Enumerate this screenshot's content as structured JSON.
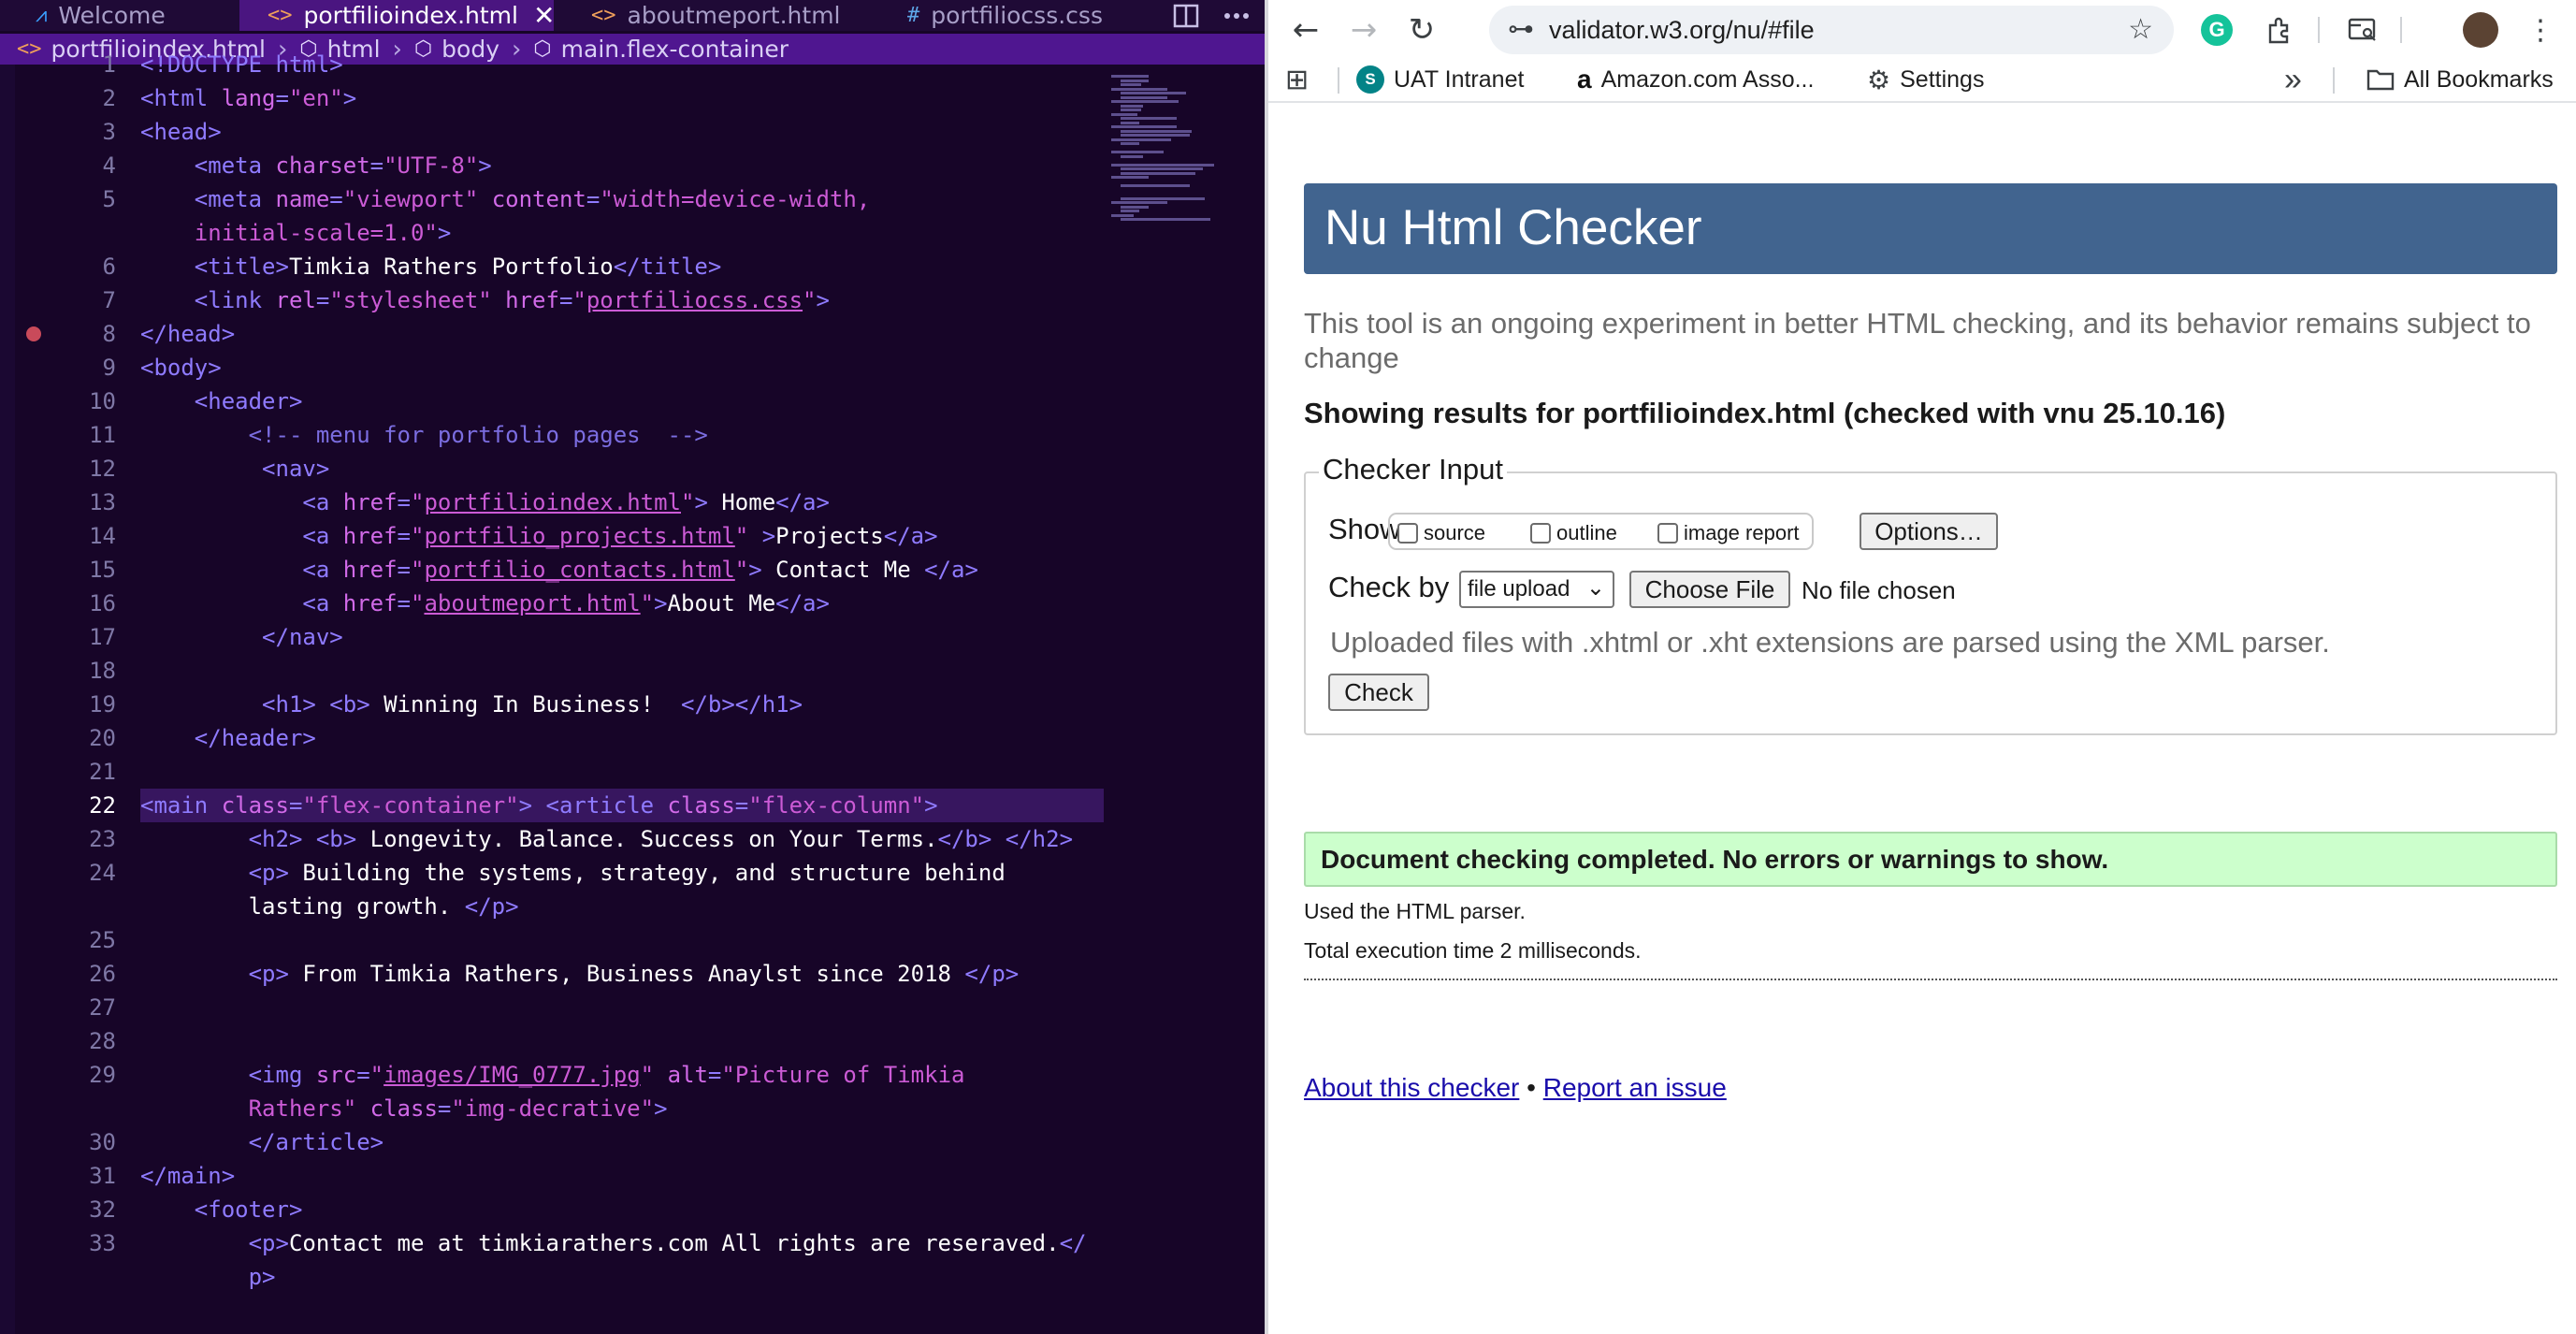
{
  "editor": {
    "tabs": [
      {
        "icon": "vscode-icon",
        "label": "Welcome",
        "active": false
      },
      {
        "icon": "html-icon",
        "label": "portfilioindex.html",
        "active": true
      },
      {
        "icon": "html-icon",
        "label": "aboutmeport.html",
        "active": false
      },
      {
        "icon": "css-icon",
        "label": "portfiliocss.css",
        "active": false
      }
    ],
    "close_glyph": "✕",
    "tab_glyphs": {
      "vscode": "⩘",
      "html": "<>",
      "css": "#"
    },
    "breadcrumb": [
      {
        "icon": "html-icon",
        "glyph": "<>",
        "label": "portfilioindex.html"
      },
      {
        "icon": "element-icon",
        "glyph": "⬡",
        "label": "html"
      },
      {
        "icon": "element-icon",
        "glyph": "⬡",
        "label": "body"
      },
      {
        "icon": "element-icon",
        "glyph": "⬡",
        "label": "main.flex-container"
      }
    ],
    "current_line": 22,
    "breakpoint_line": 8,
    "code_lines": [
      {
        "n": "1",
        "spans": [
          [
            "tag",
            "<!DOCTYPE html>"
          ]
        ]
      },
      {
        "n": "2",
        "spans": [
          [
            "tag",
            "<html "
          ],
          [
            "attr",
            "lang"
          ],
          [
            "tag",
            "="
          ],
          [
            "val",
            "\"en\""
          ],
          [
            "tag",
            ">"
          ]
        ]
      },
      {
        "n": "3",
        "spans": [
          [
            "tag",
            "<head>"
          ]
        ]
      },
      {
        "n": "4",
        "spans": [
          [
            "txt",
            "    "
          ],
          [
            "tag",
            "<meta "
          ],
          [
            "attr",
            "charset"
          ],
          [
            "tag",
            "="
          ],
          [
            "val",
            "\"UTF-8\""
          ],
          [
            "tag",
            ">"
          ]
        ]
      },
      {
        "n": "5",
        "spans": [
          [
            "txt",
            "    "
          ],
          [
            "tag",
            "<meta "
          ],
          [
            "attr",
            "name"
          ],
          [
            "tag",
            "="
          ],
          [
            "val",
            "\"viewport\""
          ],
          [
            "txt",
            " "
          ],
          [
            "attr",
            "content"
          ],
          [
            "tag",
            "="
          ],
          [
            "val",
            "\"width=device-width,"
          ]
        ]
      },
      {
        "n": "",
        "spans": [
          [
            "txt",
            "    "
          ],
          [
            "val",
            "initial-scale=1.0\""
          ],
          [
            "tag",
            ">"
          ]
        ]
      },
      {
        "n": "6",
        "spans": [
          [
            "txt",
            "    "
          ],
          [
            "tag",
            "<title>"
          ],
          [
            "txt",
            "Timkia Rathers Portfolio"
          ],
          [
            "tag",
            "</title>"
          ]
        ]
      },
      {
        "n": "7",
        "spans": [
          [
            "txt",
            "    "
          ],
          [
            "tag",
            "<link "
          ],
          [
            "attr",
            "rel"
          ],
          [
            "tag",
            "="
          ],
          [
            "val",
            "\"stylesheet\""
          ],
          [
            "txt",
            " "
          ],
          [
            "attr",
            "href"
          ],
          [
            "tag",
            "="
          ],
          [
            "val",
            "\""
          ],
          [
            "link",
            "portfiliocss.css"
          ],
          [
            "val",
            "\""
          ],
          [
            "tag",
            ">"
          ]
        ]
      },
      {
        "n": "8",
        "spans": [
          [
            "tag",
            "</head>"
          ]
        ]
      },
      {
        "n": "9",
        "spans": [
          [
            "tag",
            "<body>"
          ]
        ]
      },
      {
        "n": "10",
        "spans": [
          [
            "txt",
            "    "
          ],
          [
            "tag",
            "<header>"
          ]
        ]
      },
      {
        "n": "11",
        "spans": [
          [
            "txt",
            "        "
          ],
          [
            "com",
            "<!-- menu for portfolio pages  -->"
          ]
        ]
      },
      {
        "n": "12",
        "spans": [
          [
            "txt",
            "         "
          ],
          [
            "tag",
            "<nav>"
          ]
        ]
      },
      {
        "n": "13",
        "spans": [
          [
            "txt",
            "            "
          ],
          [
            "tag",
            "<a "
          ],
          [
            "attr",
            "href"
          ],
          [
            "tag",
            "="
          ],
          [
            "val",
            "\""
          ],
          [
            "link",
            "portfilioindex.html"
          ],
          [
            "val",
            "\""
          ],
          [
            "tag",
            ">"
          ],
          [
            "txt",
            " Home"
          ],
          [
            "tag",
            "</a>"
          ]
        ]
      },
      {
        "n": "14",
        "spans": [
          [
            "txt",
            "            "
          ],
          [
            "tag",
            "<a "
          ],
          [
            "attr",
            "href"
          ],
          [
            "tag",
            "="
          ],
          [
            "val",
            "\""
          ],
          [
            "link",
            "portfilio_projects.html"
          ],
          [
            "val",
            "\""
          ],
          [
            "txt",
            " "
          ],
          [
            "tag",
            ">"
          ],
          [
            "txt",
            "Projects"
          ],
          [
            "tag",
            "</a>"
          ]
        ]
      },
      {
        "n": "15",
        "spans": [
          [
            "txt",
            "            "
          ],
          [
            "tag",
            "<a "
          ],
          [
            "attr",
            "href"
          ],
          [
            "tag",
            "="
          ],
          [
            "val",
            "\""
          ],
          [
            "link",
            "portfilio_contacts.html"
          ],
          [
            "val",
            "\""
          ],
          [
            "tag",
            ">"
          ],
          [
            "txt",
            " Contact Me "
          ],
          [
            "tag",
            "</a>"
          ]
        ]
      },
      {
        "n": "16",
        "spans": [
          [
            "txt",
            "            "
          ],
          [
            "tag",
            "<a "
          ],
          [
            "attr",
            "href"
          ],
          [
            "tag",
            "="
          ],
          [
            "val",
            "\""
          ],
          [
            "link",
            "aboutmeport.html"
          ],
          [
            "val",
            "\""
          ],
          [
            "tag",
            ">"
          ],
          [
            "txt",
            "About Me"
          ],
          [
            "tag",
            "</a>"
          ]
        ]
      },
      {
        "n": "17",
        "spans": [
          [
            "txt",
            "         "
          ],
          [
            "tag",
            "</nav>"
          ]
        ]
      },
      {
        "n": "18",
        "spans": []
      },
      {
        "n": "19",
        "spans": [
          [
            "txt",
            "         "
          ],
          [
            "tag",
            "<h1>"
          ],
          [
            "txt",
            " "
          ],
          [
            "tag",
            "<b>"
          ],
          [
            "txt",
            " Winning In Business!  "
          ],
          [
            "tag",
            "</b></h1>"
          ]
        ]
      },
      {
        "n": "20",
        "spans": [
          [
            "txt",
            "    "
          ],
          [
            "tag",
            "</header>"
          ]
        ]
      },
      {
        "n": "21",
        "spans": []
      },
      {
        "n": "22",
        "spans": [
          [
            "tag",
            "<main "
          ],
          [
            "attr",
            "class"
          ],
          [
            "tag",
            "="
          ],
          [
            "val",
            "\"flex-container\""
          ],
          [
            "tag",
            ">"
          ],
          [
            "txt",
            " "
          ],
          [
            "tag",
            "<article "
          ],
          [
            "attr",
            "class"
          ],
          [
            "tag",
            "="
          ],
          [
            "val",
            "\"flex-column\""
          ],
          [
            "tag",
            ">"
          ]
        ]
      },
      {
        "n": "23",
        "spans": [
          [
            "txt",
            "        "
          ],
          [
            "tag",
            "<h2>"
          ],
          [
            "txt",
            " "
          ],
          [
            "tag",
            "<b>"
          ],
          [
            "txt",
            " Longevity. Balance. Success on Your Terms."
          ],
          [
            "tag",
            "</b>"
          ],
          [
            "txt",
            " "
          ],
          [
            "tag",
            "</h2>"
          ]
        ]
      },
      {
        "n": "24",
        "spans": [
          [
            "txt",
            "        "
          ],
          [
            "tag",
            "<p>"
          ],
          [
            "txt",
            " Building the systems, strategy, and structure behind"
          ]
        ]
      },
      {
        "n": "",
        "spans": [
          [
            "txt",
            "        lasting growth. "
          ],
          [
            "tag",
            "</p>"
          ]
        ]
      },
      {
        "n": "25",
        "spans": []
      },
      {
        "n": "26",
        "spans": [
          [
            "txt",
            "        "
          ],
          [
            "tag",
            "<p>"
          ],
          [
            "txt",
            " From Timkia Rathers, Business Anaylst since 2018 "
          ],
          [
            "tag",
            "</p>"
          ]
        ]
      },
      {
        "n": "27",
        "spans": []
      },
      {
        "n": "28",
        "spans": []
      },
      {
        "n": "29",
        "spans": [
          [
            "txt",
            "        "
          ],
          [
            "tag",
            "<img "
          ],
          [
            "attr",
            "src"
          ],
          [
            "tag",
            "="
          ],
          [
            "val",
            "\""
          ],
          [
            "link",
            "images/IMG_0777.jpg"
          ],
          [
            "val",
            "\""
          ],
          [
            "txt",
            " "
          ],
          [
            "attr",
            "alt"
          ],
          [
            "tag",
            "="
          ],
          [
            "val",
            "\"Picture of Timkia"
          ]
        ]
      },
      {
        "n": "",
        "spans": [
          [
            "txt",
            "        "
          ],
          [
            "val",
            "Rathers\""
          ],
          [
            "txt",
            " "
          ],
          [
            "attr",
            "class"
          ],
          [
            "tag",
            "="
          ],
          [
            "val",
            "\"img-decrative\""
          ],
          [
            "tag",
            ">"
          ]
        ]
      },
      {
        "n": "30",
        "spans": [
          [
            "txt",
            "        "
          ],
          [
            "tag",
            "</article>"
          ]
        ]
      },
      {
        "n": "31",
        "spans": [
          [
            "tag",
            "</main>"
          ]
        ]
      },
      {
        "n": "32",
        "spans": [
          [
            "txt",
            "    "
          ],
          [
            "tag",
            "<footer>"
          ]
        ]
      },
      {
        "n": "33",
        "spans": [
          [
            "txt",
            "        "
          ],
          [
            "tag",
            "<p>"
          ],
          [
            "txt",
            "Contact me at timkiarathers.com All rights are reseraved."
          ],
          [
            "tag",
            "</"
          ]
        ]
      },
      {
        "n": "",
        "spans": [
          [
            "txt",
            "        "
          ],
          [
            "tag",
            "p>"
          ]
        ]
      }
    ]
  },
  "browser": {
    "nav": {
      "back": "←",
      "forward": "→",
      "reload": "↻"
    },
    "url": "validator.w3.org/nu/#file",
    "icons": {
      "tune": "⊶",
      "star": "☆",
      "grammarly": "G",
      "extensions": "⧉",
      "search_tabs": "⧉",
      "menu": "⋮",
      "apps": "⊞",
      "overflow": "»",
      "folder": "🗀",
      "settings": "⚙"
    },
    "bookmarks": [
      {
        "icon": "sharepoint-icon",
        "glyph": "S",
        "label": "UAT Intranet"
      },
      {
        "icon": "amazon-icon",
        "glyph": "a",
        "label": "Amazon.com Asso..."
      },
      {
        "icon": "gear-icon",
        "glyph": "⚙",
        "label": "Settings"
      }
    ],
    "all_bookmarks": "All Bookmarks"
  },
  "checker": {
    "title": "Nu Html Checker",
    "intro": "This tool is an ongoing experiment in better HTML checking, and its behavior remains subject to change",
    "results_for": "Showing results for portfilioindex.html (checked with vnu 25.10.16)",
    "legend": "Checker Input",
    "show_label": "Show",
    "show_options": [
      "source",
      "outline",
      "image report"
    ],
    "options_button": "Options…",
    "check_by_label": "Check by",
    "check_by_value": "file upload",
    "choose_file": "Choose File",
    "no_file": "No file chosen",
    "xhtml_note": "Uploaded files with .xhtml or .xht extensions are parsed using the XML parser.",
    "check_button": "Check",
    "success": "Document checking completed. No errors or warnings to show.",
    "parser_note": "Used the HTML parser.",
    "exec_note": "Total execution time 2 milliseconds.",
    "about_link": "About this checker",
    "bullet": "•",
    "report_link": "Report an issue"
  }
}
